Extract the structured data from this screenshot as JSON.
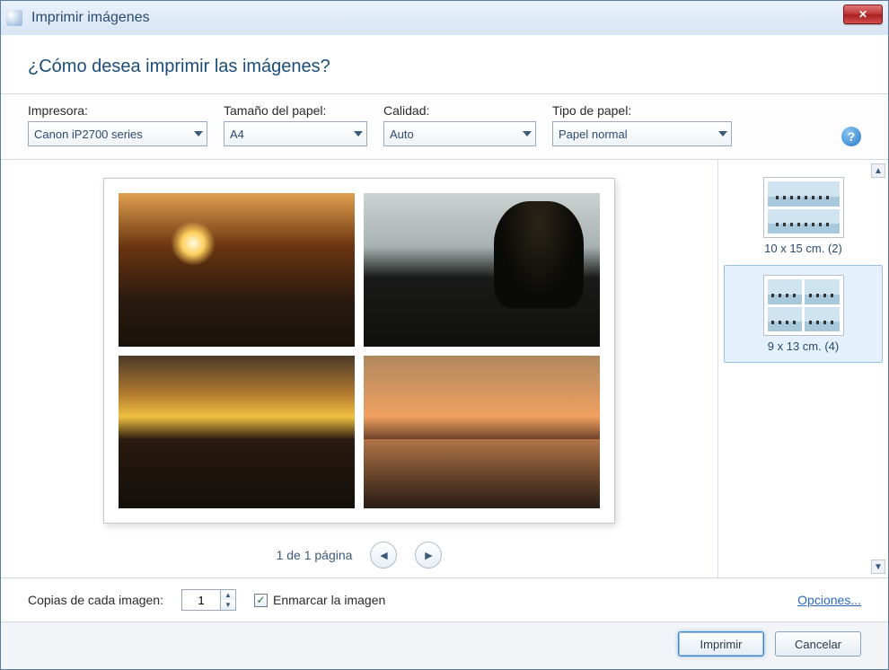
{
  "window": {
    "title": "Imprimir imágenes"
  },
  "header": {
    "question": "¿Cómo desea imprimir las imágenes?"
  },
  "options": {
    "printer": {
      "label": "Impresora:",
      "value": "Canon iP2700 series"
    },
    "paperSize": {
      "label": "Tamaño del papel:",
      "value": "A4"
    },
    "quality": {
      "label": "Calidad:",
      "value": "Auto"
    },
    "paperType": {
      "label": "Tipo de papel:",
      "value": "Papel normal"
    }
  },
  "pager": {
    "text": "1 de 1 página"
  },
  "layouts": [
    {
      "label": "10 x 15 cm. (2)",
      "grid": "two",
      "selected": false
    },
    {
      "label": "9 x 13 cm. (4)",
      "grid": "four",
      "selected": true
    }
  ],
  "bottom": {
    "copiesLabel": "Copias de cada imagen:",
    "copiesValue": "1",
    "fitLabel": "Enmarcar la imagen",
    "fitChecked": true,
    "optionsLink": "Opciones..."
  },
  "actions": {
    "print": "Imprimir",
    "cancel": "Cancelar"
  }
}
